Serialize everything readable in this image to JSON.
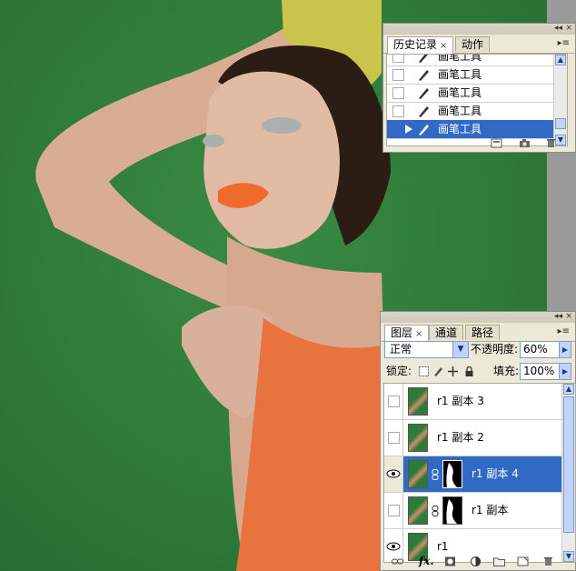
{
  "history_panel": {
    "tabs": [
      {
        "label": "历史记录",
        "active": true,
        "close": "×"
      },
      {
        "label": "动作",
        "active": false
      }
    ],
    "items": [
      {
        "label": "画笔工具",
        "selected": false
      },
      {
        "label": "画笔工具",
        "selected": false
      },
      {
        "label": "画笔工具",
        "selected": false
      },
      {
        "label": "画笔工具",
        "selected": false
      },
      {
        "label": "画笔工具",
        "selected": true
      }
    ],
    "footer_icons": [
      "new-document-icon",
      "camera-snapshot-icon",
      "trash-icon"
    ]
  },
  "layers_panel": {
    "tabs": [
      {
        "label": "图层",
        "active": true,
        "close": "×"
      },
      {
        "label": "通道",
        "active": false
      },
      {
        "label": "路径",
        "active": false
      }
    ],
    "blend_mode": "正常",
    "opacity_label": "不透明度:",
    "opacity_value": "60%",
    "lock_label": "锁定:",
    "fill_label": "填充:",
    "fill_value": "100%",
    "layers": [
      {
        "name": "r1 副本 3",
        "visible": false,
        "mask": false,
        "selected": false
      },
      {
        "name": "r1 副本 2",
        "visible": false,
        "mask": false,
        "selected": false
      },
      {
        "name": "r1 副本 4",
        "visible": true,
        "mask": true,
        "selected": true
      },
      {
        "name": "r1 副本",
        "visible": false,
        "mask": true,
        "selected": false
      },
      {
        "name": "r1",
        "visible": true,
        "mask": false,
        "selected": false
      }
    ],
    "footer_icons": [
      "link-icon",
      "fx-icon",
      "mask-icon",
      "adjustment-icon",
      "group-folder-icon",
      "new-layer-icon",
      "trash-icon"
    ],
    "footer_fx_label": "fx."
  },
  "colors": {
    "background_green": "#2e7a38",
    "selection_blue": "#316ac5",
    "panel_bg": "#ece9d8"
  }
}
